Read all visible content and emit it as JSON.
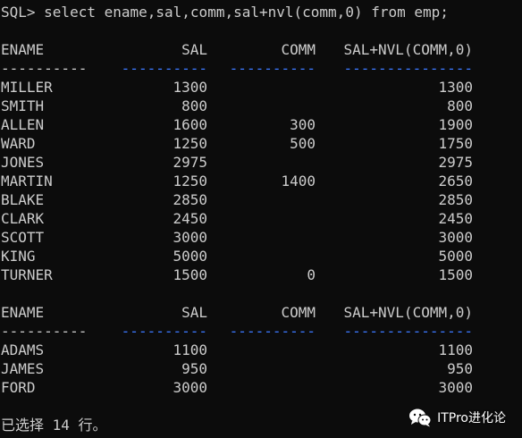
{
  "terminal": {
    "command_line": "SQL> select ename,sal,comm,sal+nvl(comm,0) from emp;",
    "headers": [
      "ENAME",
      "SAL",
      "COMM",
      "SAL+NVL(COMM,0)"
    ],
    "sep_col1": "----------",
    "sep_col2": "----------",
    "sep_col3": "----------",
    "sep_col4": "---------------",
    "block1": [
      [
        "MILLER",
        "1300",
        "",
        "1300"
      ],
      [
        "SMITH",
        "800",
        "",
        "800"
      ],
      [
        "ALLEN",
        "1600",
        "300",
        "1900"
      ],
      [
        "WARD",
        "1250",
        "500",
        "1750"
      ],
      [
        "JONES",
        "2975",
        "",
        "2975"
      ],
      [
        "MARTIN",
        "1250",
        "1400",
        "2650"
      ],
      [
        "BLAKE",
        "2850",
        "",
        "2850"
      ],
      [
        "CLARK",
        "2450",
        "",
        "2450"
      ],
      [
        "SCOTT",
        "3000",
        "",
        "3000"
      ],
      [
        "KING",
        "5000",
        "",
        "5000"
      ],
      [
        "TURNER",
        "1500",
        "0",
        "1500"
      ]
    ],
    "block2": [
      [
        "ADAMS",
        "1100",
        "",
        "1100"
      ],
      [
        "JAMES",
        "950",
        "",
        "950"
      ],
      [
        "FORD",
        "3000",
        "",
        "3000"
      ]
    ],
    "footer": "已选择 14 行。"
  },
  "watermark": {
    "text": "ITPro进化论",
    "icon": "wechat-icon"
  },
  "colors": {
    "background": "#0c0c0c",
    "text": "#cccccc",
    "separator_blue": "#3b78ff"
  }
}
